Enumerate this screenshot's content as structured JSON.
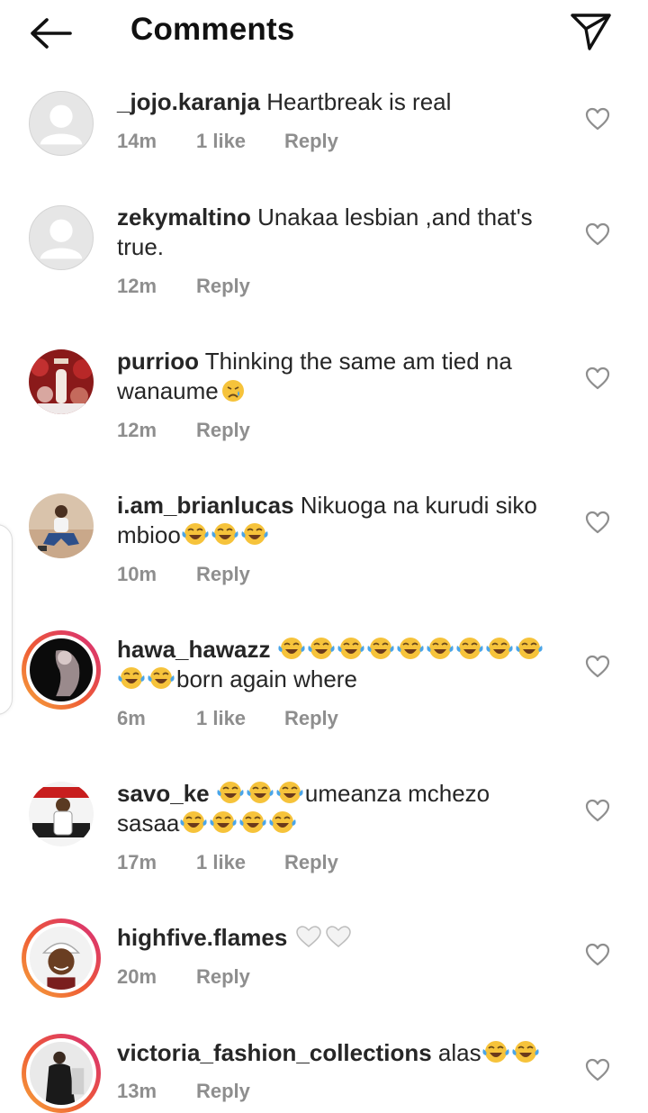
{
  "header": {
    "title": "Comments",
    "back_icon": "arrow-left-icon",
    "send_icon": "paper-plane-icon"
  },
  "reply_label": "Reply",
  "comments": [
    {
      "username": "_jojo.karanja",
      "text": "Heartbreak is real",
      "time": "14m",
      "likes": "1 like",
      "avatar": "default"
    },
    {
      "username": "zekymaltino",
      "text": "Unakaa lesbian ,and that's true.",
      "time": "12m",
      "likes": "",
      "avatar": "default"
    },
    {
      "username": "purrioo",
      "text": "Thinking the same am tied na wanaume",
      "emoji_after": "crying-face",
      "time": "12m",
      "likes": "",
      "avatar": "photo"
    },
    {
      "username": "i.am_brianlucas",
      "text": "Nikuoga na kurudi siko mbioo",
      "emoji_after": "joy x3",
      "time": "10m",
      "likes": "",
      "avatar": "photo"
    },
    {
      "username": "hawa_hawazz",
      "emoji_before": "joy x11",
      "text": "born again where",
      "time": "6m",
      "likes": "1 like",
      "avatar": "story-ring"
    },
    {
      "username": "savo_ke",
      "emoji_before": "joy x3",
      "text": "umeanza mchezo sasaa",
      "emoji_after": "joy x4",
      "time": "17m",
      "likes": "1 like",
      "avatar": "photo"
    },
    {
      "username": "highfive.flames",
      "emoji_after": "white-heart x2",
      "text": "",
      "time": "20m",
      "likes": "",
      "avatar": "story-ring"
    },
    {
      "username": "victoria_fashion_collections",
      "text": "alas",
      "emoji_after": "joy x2",
      "time": "13m",
      "likes": "",
      "avatar": "story-ring"
    }
  ],
  "colors": {
    "text": "#262626",
    "meta": "#8e8e8e",
    "story_ring_start": "#f6a73b",
    "story_ring_end": "#d62d7b"
  }
}
